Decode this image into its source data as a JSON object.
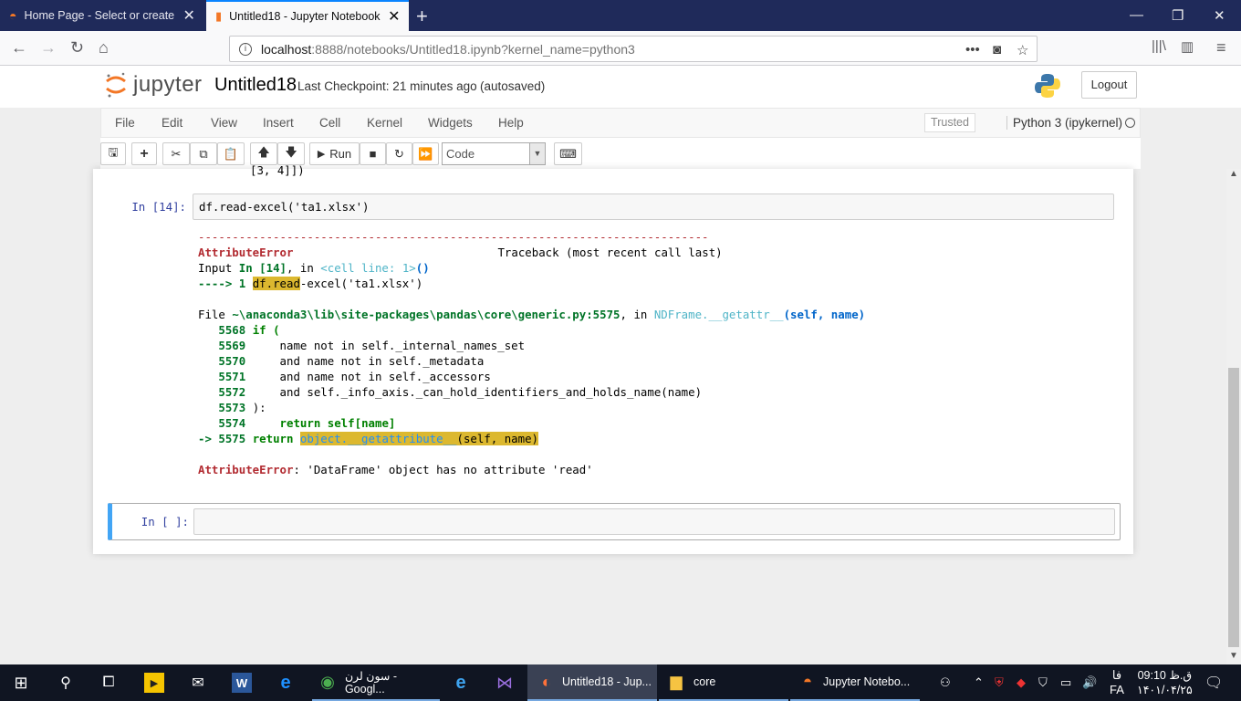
{
  "browser": {
    "tabs": [
      {
        "title": "Home Page - Select or create a",
        "active": false
      },
      {
        "title": "Untitled18 - Jupyter Notebook",
        "active": true
      }
    ],
    "new_tab": "+",
    "url_host": "localhost",
    "url_rest": ":8888/notebooks/Untitled18.ipynb?kernel_name=python3",
    "icons": [
      "back-icon",
      "forward-icon",
      "reload-icon",
      "home-icon",
      "page-actions-icon",
      "pocket-icon",
      "bookmark-star-icon",
      "library-icon",
      "sidebar-icon",
      "hamburger-menu-icon"
    ]
  },
  "header": {
    "logo_text": "jupyter",
    "notebook_name": "Untitled18",
    "checkpoint": "Last Checkpoint: 21 minutes ago",
    "autosaved": "(autosaved)",
    "logout": "Logout"
  },
  "menubar": {
    "items": [
      "File",
      "Edit",
      "View",
      "Insert",
      "Cell",
      "Kernel",
      "Widgets",
      "Help"
    ],
    "trusted": "Trusted",
    "kernel": "Python 3 (ipykernel)"
  },
  "toolbar": {
    "run_label": "Run",
    "cell_type": "Code"
  },
  "notebook": {
    "prev_output": "[3, 4]])",
    "cell1": {
      "prompt": "In [14]:",
      "code": "df.read-excel('ta1.xlsx')"
    },
    "traceback": {
      "dashes": "---------------------------------------------------------------------------",
      "error_name": "AttributeError",
      "traceback_header": "Traceback (most recent call last)",
      "input_prefix": "Input ",
      "input_in": "In [14]",
      "input_mid": ", in ",
      "input_cell_line": "<cell line: 1>",
      "input_paren": "()",
      "arrow_line_prefix": "----> 1 ",
      "arrow_hl": "df.read",
      "arrow_rest": "-excel('ta1.xlsx')",
      "file_prefix": "File ",
      "file_path": "~\\anaconda3\\lib\\site-packages\\pandas\\core\\generic.py:5575",
      "file_in": ", in ",
      "file_func": "NDFrame.__getattr__",
      "file_args": "(self, name)",
      "lines": [
        {
          "num": "5568",
          "code": "if ("
        },
        {
          "num": "5569",
          "code": "name not in self._internal_names_set"
        },
        {
          "num": "5570",
          "code": "and name not in self._metadata"
        },
        {
          "num": "5571",
          "code": "and name not in self._accessors"
        },
        {
          "num": "5572",
          "code": "and self._info_axis._can_hold_identifiers_and_holds_name(name)"
        },
        {
          "num": "5573",
          "code": "):"
        },
        {
          "num": "5574",
          "code": "return self[name]"
        }
      ],
      "current_line_arrow": "-> 5575",
      "current_return": "return",
      "current_hl": "object.__getattribute__",
      "current_args": "(self, name)",
      "final_error": "AttributeError",
      "final_msg": ": 'DataFrame' object has no attribute 'read'"
    },
    "cell2": {
      "prompt": "In [ ]:"
    }
  },
  "taskbar": {
    "items": [
      {
        "label": "سون لرن - Googl..."
      },
      {
        "label": "Untitled18 - Jup..."
      },
      {
        "label": "core"
      },
      {
        "label": "Jupyter Notebo..."
      }
    ],
    "lang": "FA",
    "lang2": "فا",
    "time": "ق.ظ 09:10",
    "date": "۱۴۰۱/۰۴/۲۵"
  }
}
